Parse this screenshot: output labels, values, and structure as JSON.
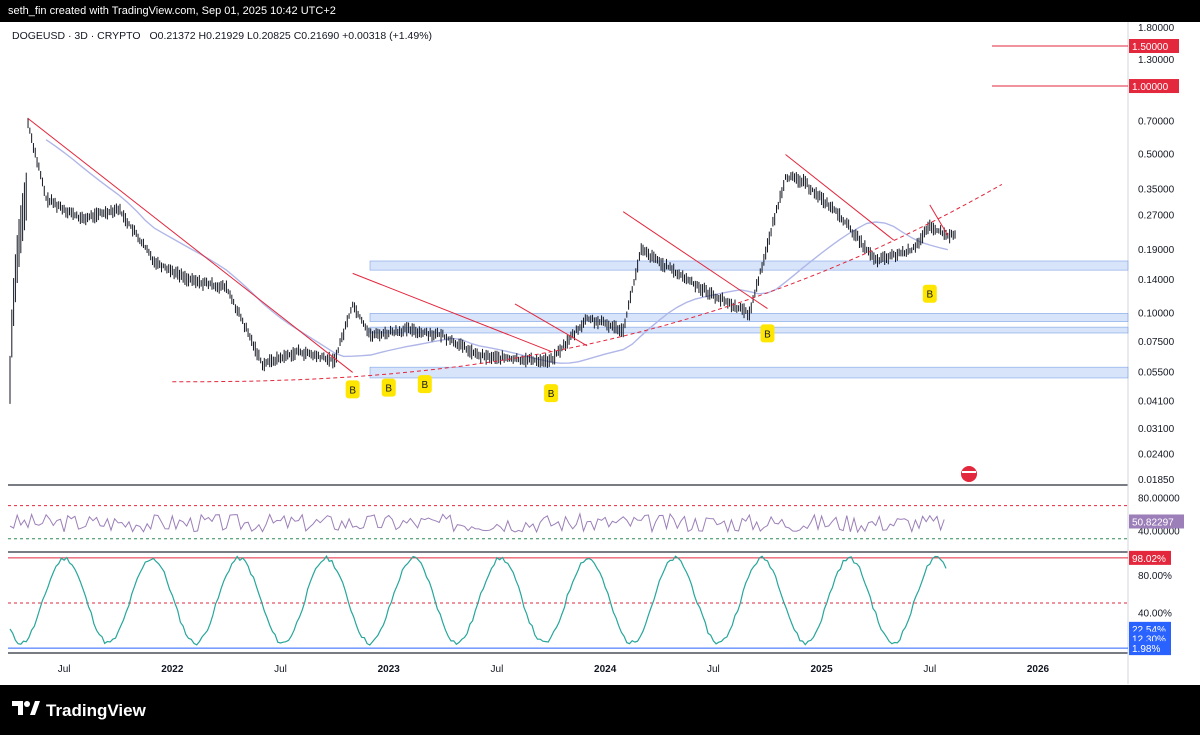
{
  "header": {
    "creator_line": "seth_fin created with TradingView.com, Sep 01, 2025 10:42 UTC+2"
  },
  "symbol_info": {
    "ticker": "DOGEUSD · 3D · CRYPTO",
    "ohlc": "O0.21372  H0.21929  L0.20825  C0.21690  +0.00318 (+1.49%)"
  },
  "footer": {
    "brand_text": "TradingView"
  },
  "chart_data": [
    {
      "type": "line",
      "title": "",
      "scale": "log",
      "x_ticks": [
        "Jul",
        "2022",
        "Jul",
        "2023",
        "Jul",
        "2024",
        "Jul",
        "2025",
        "Jul",
        "2026"
      ],
      "y_ticks": [
        "1.80000",
        "1.30000",
        "0.70000",
        "0.50000",
        "0.35000",
        "0.27000",
        "0.19000",
        "0.14000",
        "0.10000",
        "0.07500",
        "0.05500",
        "0.04100",
        "0.03100",
        "0.02400",
        "0.01850"
      ],
      "price_labels": [
        {
          "text": "1.50000",
          "value": 1.5,
          "color": "#e3273c"
        },
        {
          "text": "1.00000",
          "value": 1.0,
          "color": "#e3273c"
        }
      ],
      "series": [
        {
          "name": "",
          "x": [
            "2021-05",
            "2021-06",
            "2021-08",
            "2021-10",
            "2021-12",
            "2022-02",
            "2022-04",
            "2022-06",
            "2022-08",
            "2022-10",
            "2022-11",
            "2022-12",
            "2023-02",
            "2023-04",
            "2023-06",
            "2023-08",
            "2023-10",
            "2023-12",
            "2024-02",
            "2024-03",
            "2024-05",
            "2024-07",
            "2024-09",
            "2024-11",
            "2024-12",
            "2025-02",
            "2025-04",
            "2025-06",
            "2025-07",
            "2025-08"
          ],
          "values": [
            0.69,
            0.32,
            0.26,
            0.29,
            0.17,
            0.14,
            0.13,
            0.06,
            0.068,
            0.062,
            0.11,
            0.08,
            0.085,
            0.08,
            0.065,
            0.063,
            0.062,
            0.095,
            0.085,
            0.19,
            0.15,
            0.12,
            0.1,
            0.4,
            0.38,
            0.27,
            0.17,
            0.19,
            0.24,
            0.22
          ]
        }
      ],
      "buy_markers": [
        {
          "label": "B",
          "x": "2022-11",
          "value": 0.055
        },
        {
          "label": "B",
          "x": "2023-01",
          "value": 0.056
        },
        {
          "label": "B",
          "x": "2023-03",
          "value": 0.058
        },
        {
          "label": "B",
          "x": "2023-10",
          "value": 0.053
        },
        {
          "label": "B",
          "x": "2024-10",
          "value": 0.097
        },
        {
          "label": "B",
          "x": "2025-07",
          "value": 0.145
        }
      ],
      "support_zones": [
        {
          "from": 0.052,
          "to": 0.058
        },
        {
          "from": 0.082,
          "to": 0.087
        },
        {
          "from": 0.092,
          "to": 0.1
        },
        {
          "from": 0.155,
          "to": 0.17
        }
      ],
      "colors": {
        "candles": "#131722",
        "trendlines": "#e3273c",
        "moving_average": "#b0b7e8",
        "bull_ribbon": "#b9dcb4",
        "bear_ribbon": "#f3b6b6",
        "zones": "#a9c4f2"
      }
    },
    {
      "type": "line",
      "title": "",
      "y_ticks": [
        "80.00000",
        "40.00000"
      ],
      "last_value_label": "50.82297",
      "colors": {
        "line": "#9c7fb8",
        "upper_band": "#e3273c",
        "lower_band": "#2e8b57"
      }
    },
    {
      "type": "line",
      "title": "",
      "y_ticks": [
        "80.00%",
        "40.00%"
      ],
      "value_labels": [
        {
          "text": "98.02%",
          "color": "#e3273c"
        },
        {
          "text": "22.54%",
          "color": "#2962ff"
        },
        {
          "text": "12.30%",
          "color": "#2962ff"
        },
        {
          "text": "1.98%",
          "color": "#2962ff"
        }
      ]
    }
  ]
}
